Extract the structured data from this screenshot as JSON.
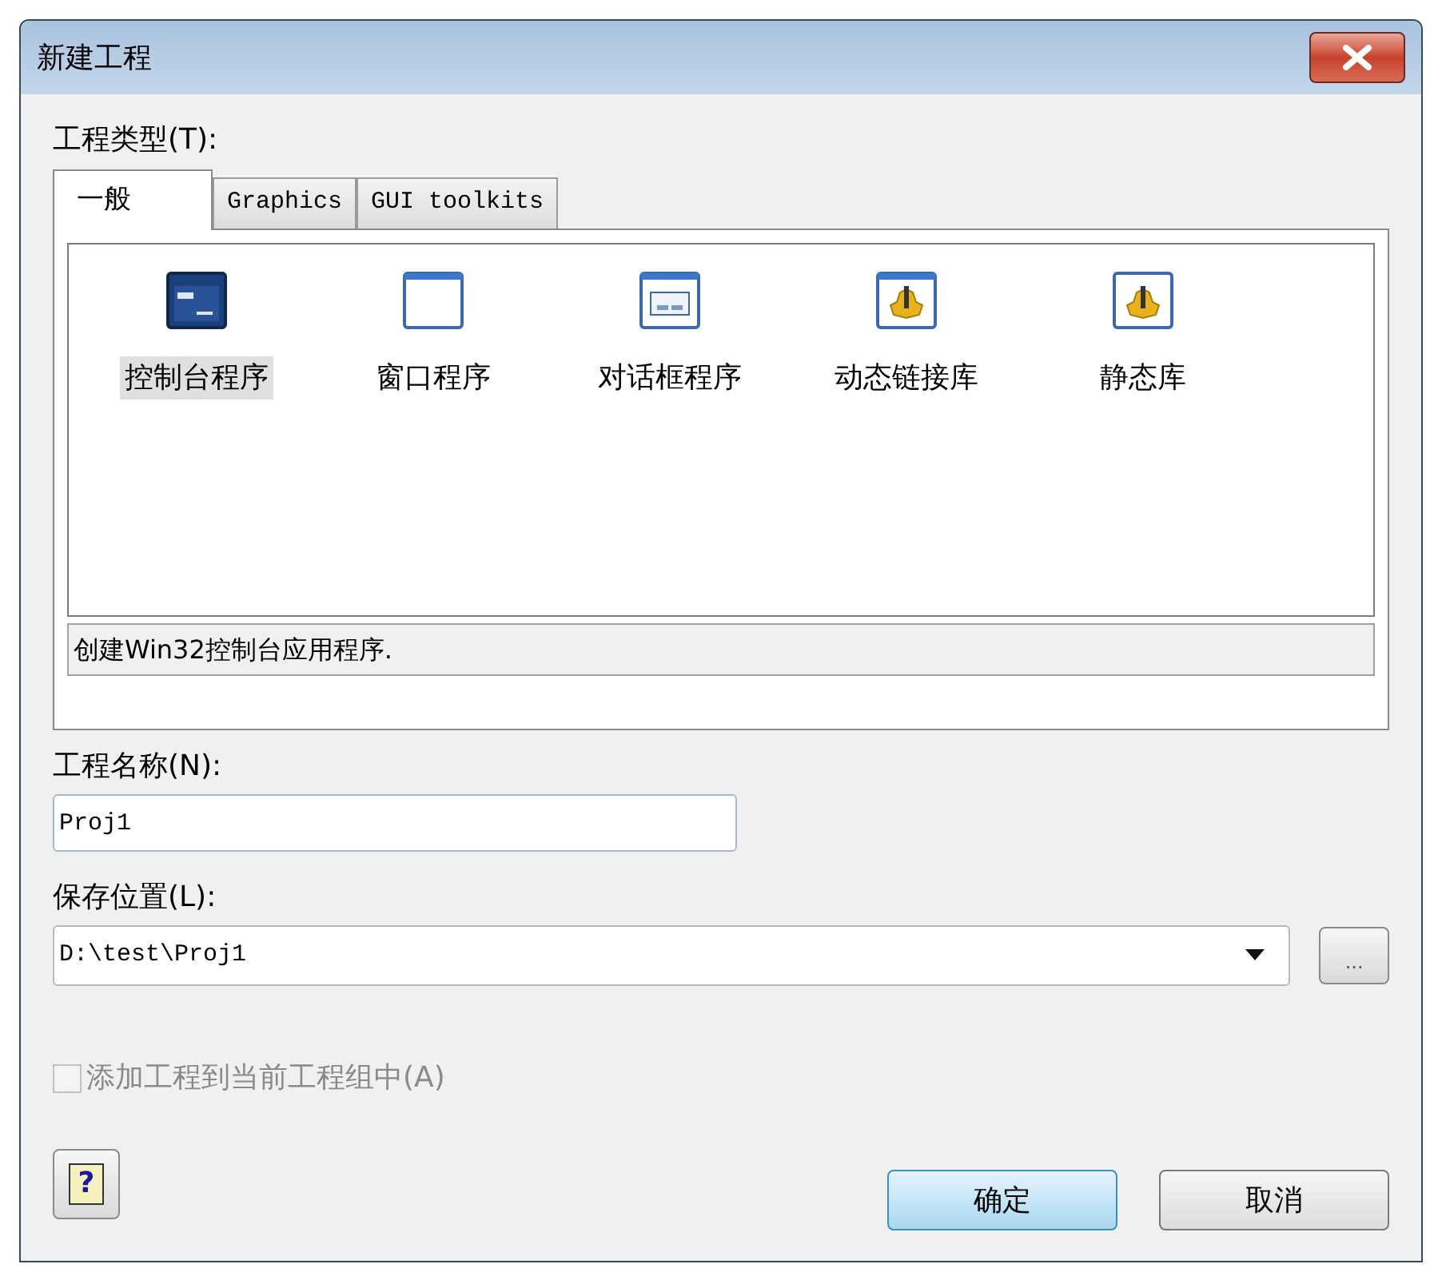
{
  "window": {
    "title": "新建工程"
  },
  "project_type": {
    "label": "工程类型(T):",
    "tabs": [
      {
        "label": "一般",
        "selected": true
      },
      {
        "label": "Graphics",
        "selected": false
      },
      {
        "label": "GUI toolkits",
        "selected": false
      }
    ],
    "templates": [
      {
        "label": "控制台程序",
        "kind": "console",
        "selected": true
      },
      {
        "label": "窗口程序",
        "kind": "window",
        "selected": false
      },
      {
        "label": "对话框程序",
        "kind": "dialog",
        "selected": false
      },
      {
        "label": "动态链接库",
        "kind": "library",
        "selected": false
      },
      {
        "label": "静态库",
        "kind": "static",
        "selected": false
      }
    ],
    "description": "创建Win32控制台应用程序."
  },
  "project_name": {
    "label": "工程名称(N):",
    "value": "Proj1"
  },
  "location": {
    "label": "保存位置(L):",
    "value": "D:\\test\\Proj1",
    "browse": "..."
  },
  "add_to_group": {
    "label": "添加工程到当前工程组中(A)",
    "checked": false,
    "disabled": true
  },
  "help_button": "?",
  "buttons": [
    {
      "label": "确定",
      "default": true
    },
    {
      "label": "取消",
      "default": false
    }
  ]
}
